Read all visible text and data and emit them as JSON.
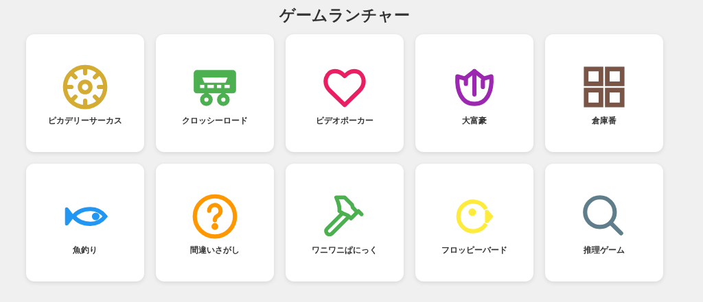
{
  "title": "ゲームランチャー",
  "games": [
    {
      "label": "ピカデリーサーカス",
      "kind": "wheel",
      "color": "#d4ac34"
    },
    {
      "label": "クロッシーロード",
      "kind": "wagon",
      "color": "#4caf50"
    },
    {
      "label": "ビデオポーカー",
      "kind": "heart",
      "color": "#e91e63"
    },
    {
      "label": "大富豪",
      "kind": "tulip",
      "color": "#9c27b0"
    },
    {
      "label": "倉庫番",
      "kind": "grid",
      "color": "#795548"
    },
    {
      "label": "魚釣り",
      "kind": "fish",
      "color": "#2196f3"
    },
    {
      "label": "間違いさがし",
      "kind": "question",
      "color": "#ff9800"
    },
    {
      "label": "ワニワニぱにっく",
      "kind": "hammer",
      "color": "#4caf50"
    },
    {
      "label": "フロッピーバード",
      "kind": "bird",
      "color": "#ffeb3b"
    },
    {
      "label": "推理ゲーム",
      "kind": "search",
      "color": "#607d8b"
    }
  ]
}
